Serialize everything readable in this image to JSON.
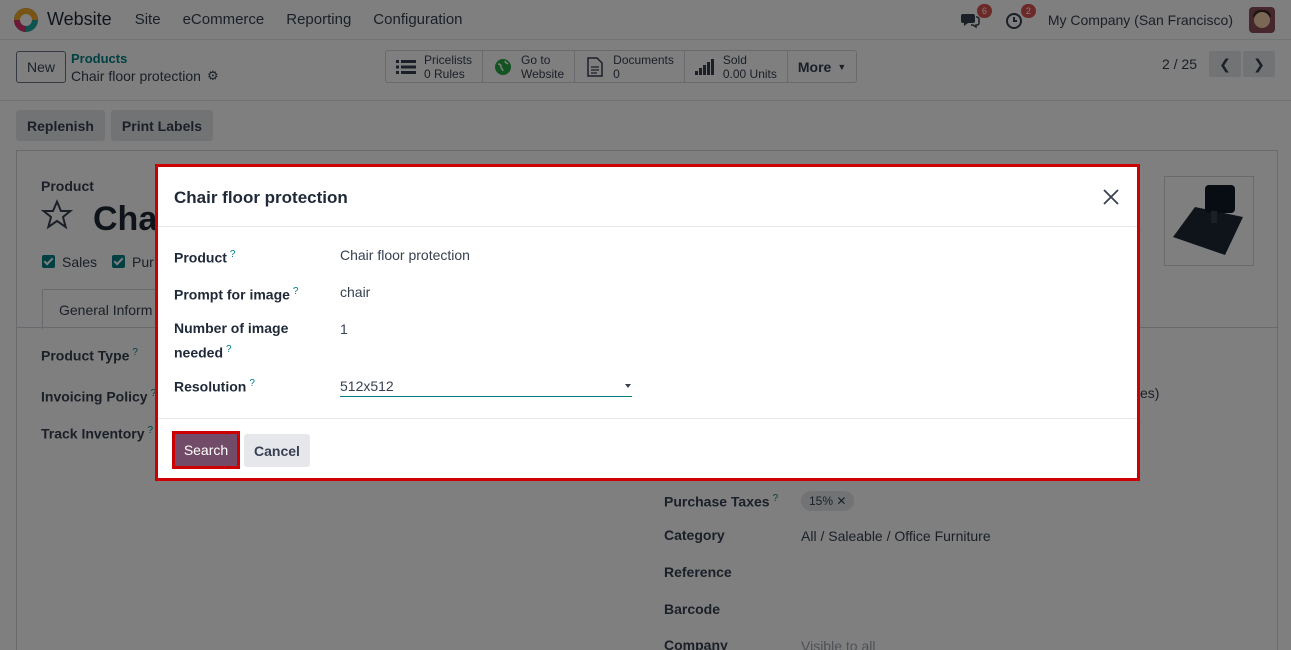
{
  "nav": {
    "app_name": "Website",
    "menu": [
      "Site",
      "eCommerce",
      "Reporting",
      "Configuration"
    ],
    "messages_count": "6",
    "activities_count": "2",
    "company": "My Company (San Francisco)"
  },
  "control": {
    "new_label": "New",
    "breadcrumb_parent": "Products",
    "breadcrumb_current": "Chair floor protection",
    "smart_buttons": [
      {
        "title": "Pricelists",
        "value": "0 Rules"
      },
      {
        "title": "Go to",
        "value": "Website"
      },
      {
        "title": "Documents",
        "value": "0"
      },
      {
        "title": "Sold",
        "value": "0.00 Units"
      }
    ],
    "more_label": "More",
    "pager": "2 / 25"
  },
  "actions": {
    "replenish": "Replenish",
    "print_labels": "Print Labels"
  },
  "form": {
    "product_label": "Product",
    "product_name_partial": "Chai",
    "sales": "Sales",
    "purchase_partial": "Pur",
    "tab_general": "General Inform",
    "product_type": "Product Type",
    "invoicing_policy": "Invoicing Policy",
    "track_inventory": "Track Inventory",
    "taxes_partial": "xes)",
    "purchase_taxes": "Purchase Taxes",
    "purchase_taxes_tag": "15%",
    "category": "Category",
    "category_value": "All / Saleable / Office Furniture",
    "reference": "Reference",
    "barcode": "Barcode",
    "company": "Company",
    "company_placeholder": "Visible to all"
  },
  "modal": {
    "title": "Chair floor protection",
    "fields": {
      "product_label": "Product",
      "product_value": "Chair floor protection",
      "prompt_label": "Prompt for image",
      "prompt_value": "chair",
      "num_label_1": "Number of image",
      "num_label_2": "needed",
      "num_value": "1",
      "resolution_label": "Resolution",
      "resolution_value": "512x512"
    },
    "search_label": "Search",
    "cancel_label": "Cancel"
  },
  "colors": {
    "accent": "#017e84",
    "primary": "#714b67",
    "highlight": "#cc0000"
  }
}
